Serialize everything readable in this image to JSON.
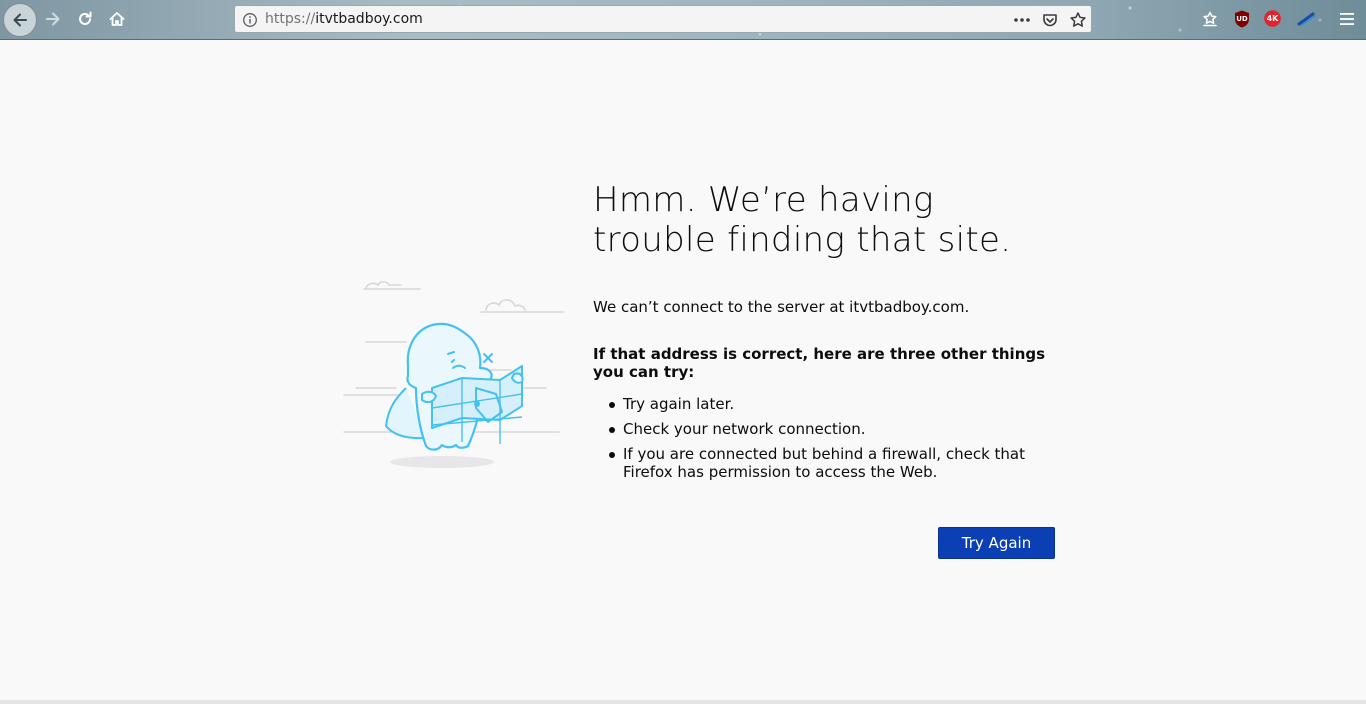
{
  "browser": {
    "url_scheme": "https://",
    "url_host": "itvtbadboy.com",
    "icons": {
      "back": "arrow-left-icon",
      "forward": "arrow-right-icon",
      "reload": "reload-icon",
      "home": "home-icon",
      "site_info": "info-icon",
      "page_actions": "more-dots-icon",
      "pocket": "pocket-icon",
      "bookmark": "star-icon",
      "library": "library-icon",
      "ublock": "ublock-icon",
      "video_4k": "video-4k-icon",
      "extension": "extension-icon",
      "menu": "hamburger-icon"
    },
    "ext_labels": {
      "ublock": "UD",
      "video_4k": "4K"
    }
  },
  "error_page": {
    "title": "Hmm. We’re having trouble finding that site.",
    "description": "We can’t connect to the server at itvtbadboy.com.",
    "subheading": "If that address is correct, here are three other things you can try:",
    "tips": [
      "Try again later.",
      "Check your network connection.",
      "If you are connected but behind a firewall, check that Firefox has permission to access the Web."
    ],
    "try_again_label": "Try Again"
  },
  "colors": {
    "accent_button": "#0b40b4",
    "illustration": "#44c1ef",
    "page_background": "#f9f9fa"
  }
}
